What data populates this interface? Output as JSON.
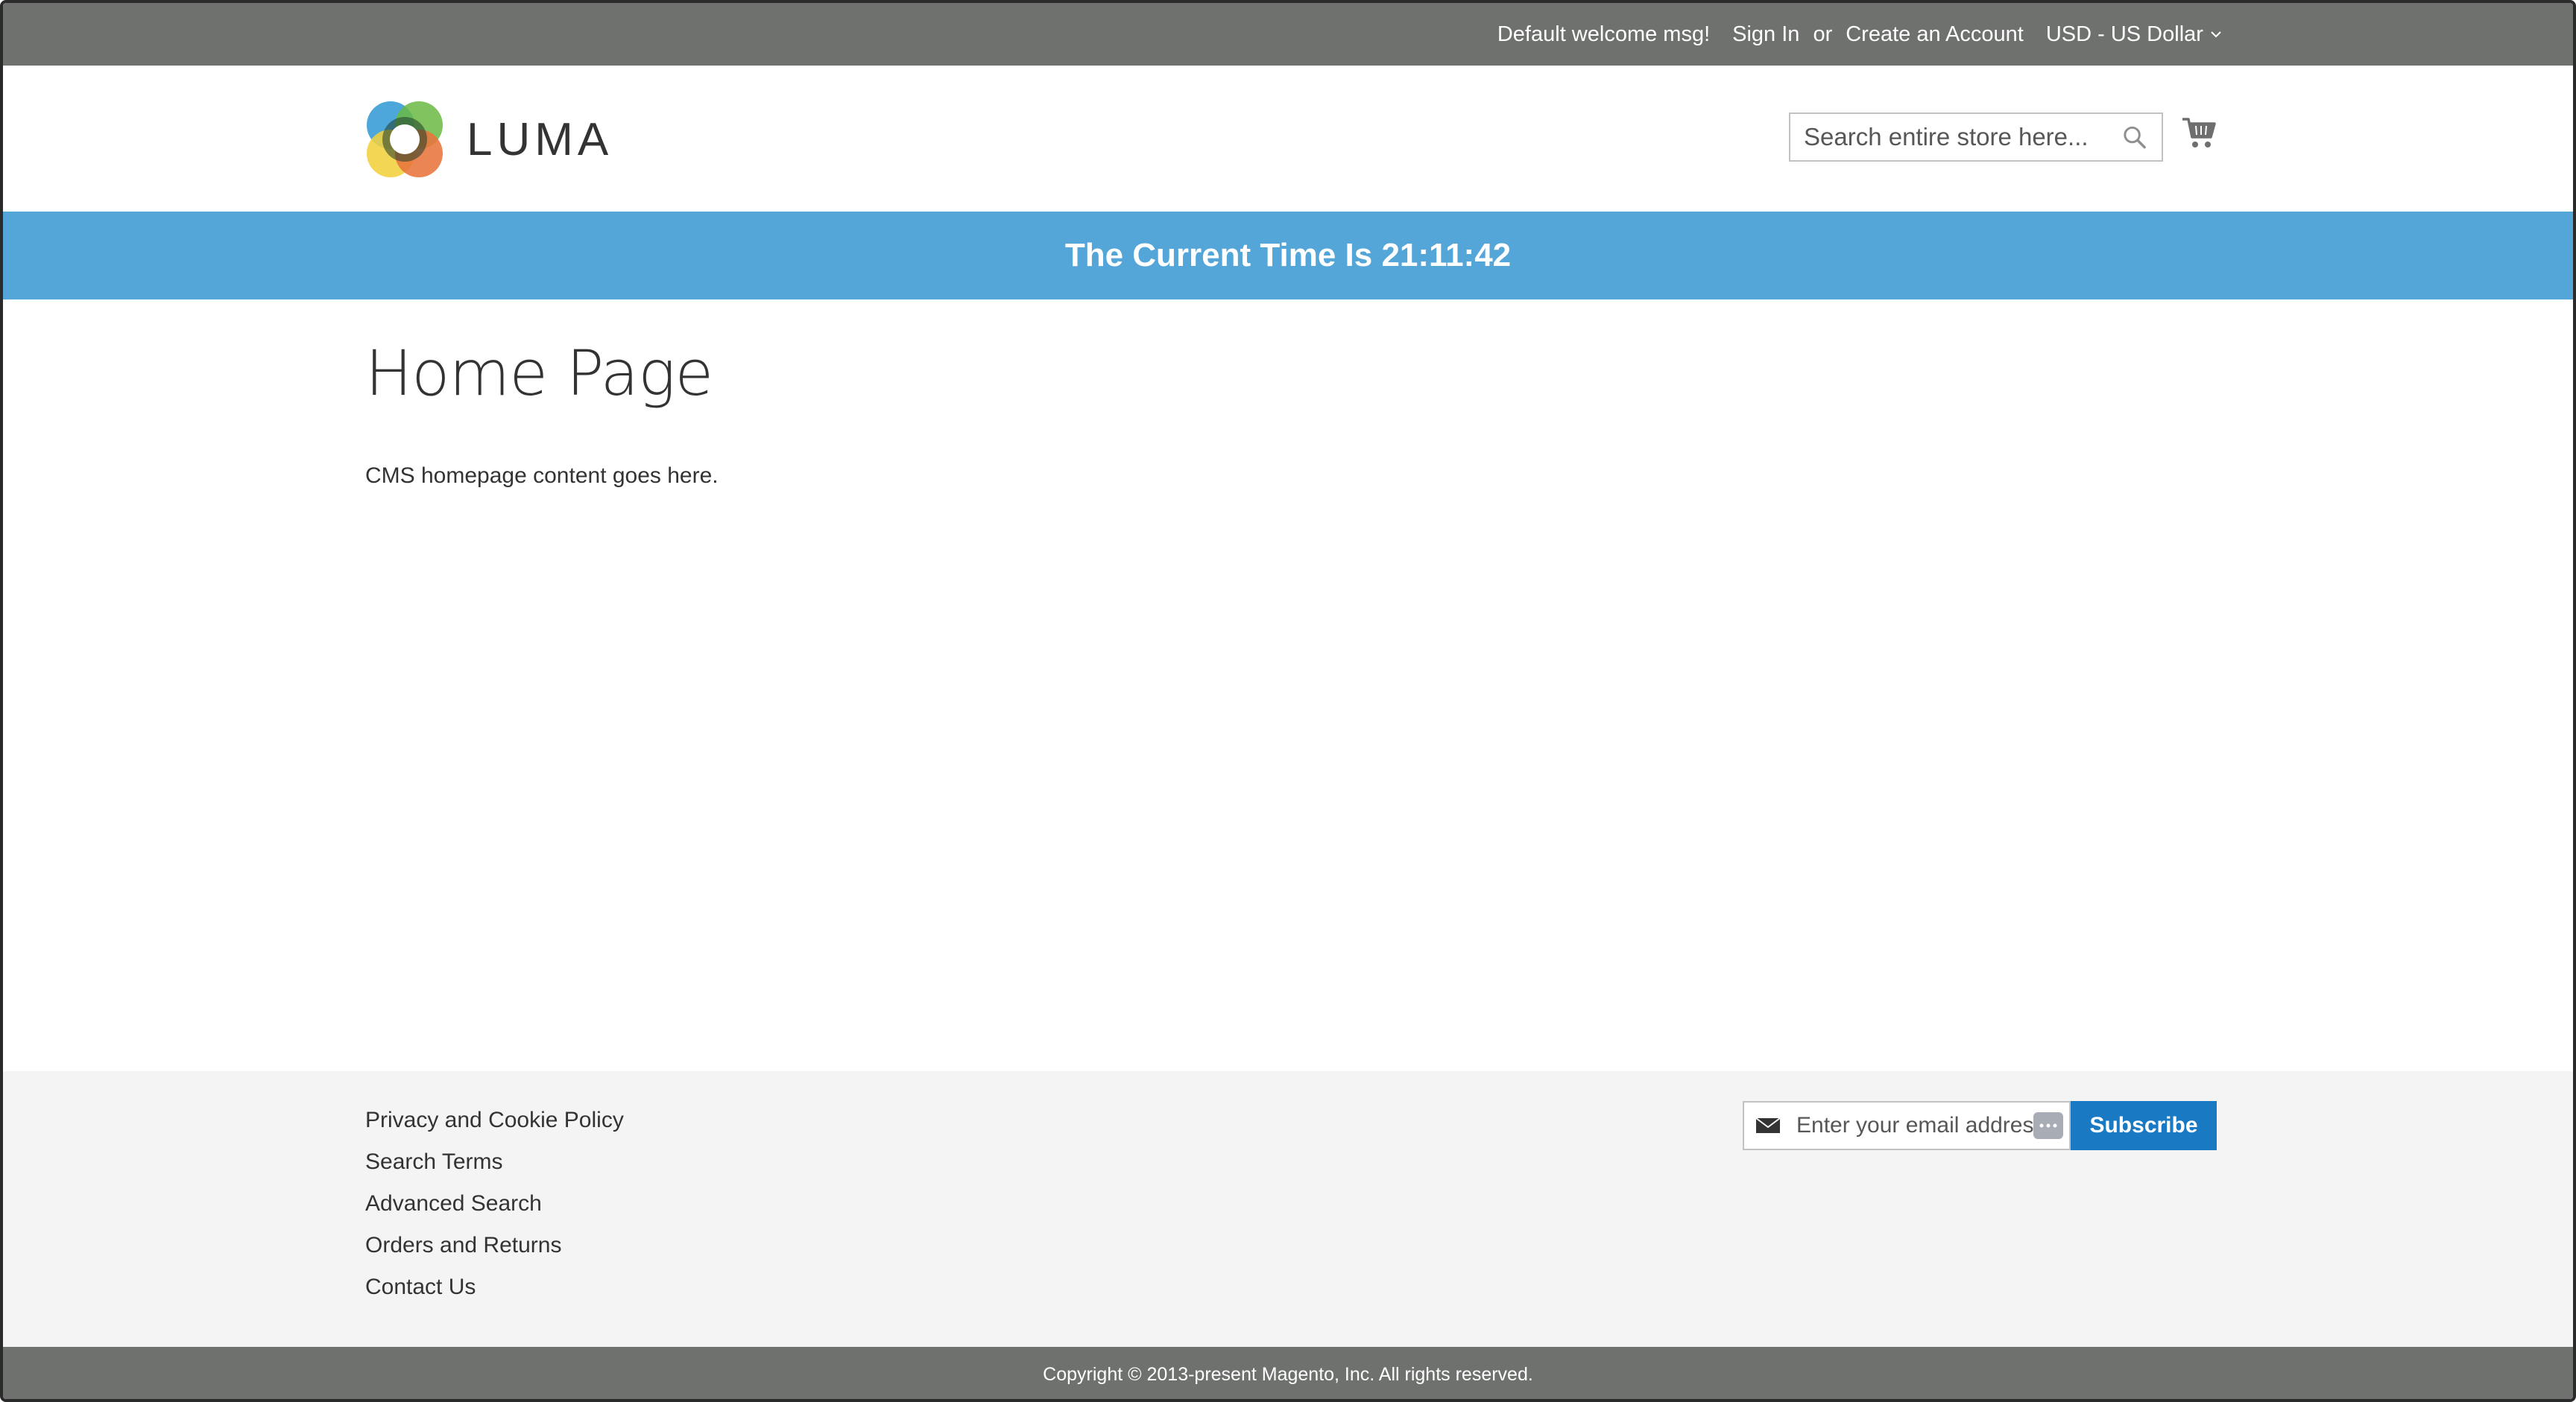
{
  "top_panel": {
    "welcome": "Default welcome msg!",
    "sign_in": "Sign In",
    "or": "or",
    "create_account": "Create an Account",
    "currency": "USD - US Dollar"
  },
  "header": {
    "logo_text": "LUMA",
    "search_placeholder": "Search entire store here...",
    "icons": [
      "search-icon",
      "cart-icon"
    ]
  },
  "notice": {
    "text": "The Current Time Is 21:11:42"
  },
  "main": {
    "title": "Home Page",
    "content": "CMS homepage content goes here."
  },
  "footer": {
    "links": [
      "Privacy and Cookie Policy",
      "Search Terms",
      "Advanced Search",
      "Orders and Returns",
      "Contact Us"
    ],
    "newsletter": {
      "placeholder": "Enter your email address",
      "button": "Subscribe"
    },
    "copyright": "Copyright © 2013-present Magento, Inc. All rights reserved."
  },
  "colors": {
    "top_panel": "#6e716e",
    "notice_bg": "#54a6d9",
    "subscribe_bg": "#1979c3",
    "footer_bg": "#f4f4f4"
  }
}
